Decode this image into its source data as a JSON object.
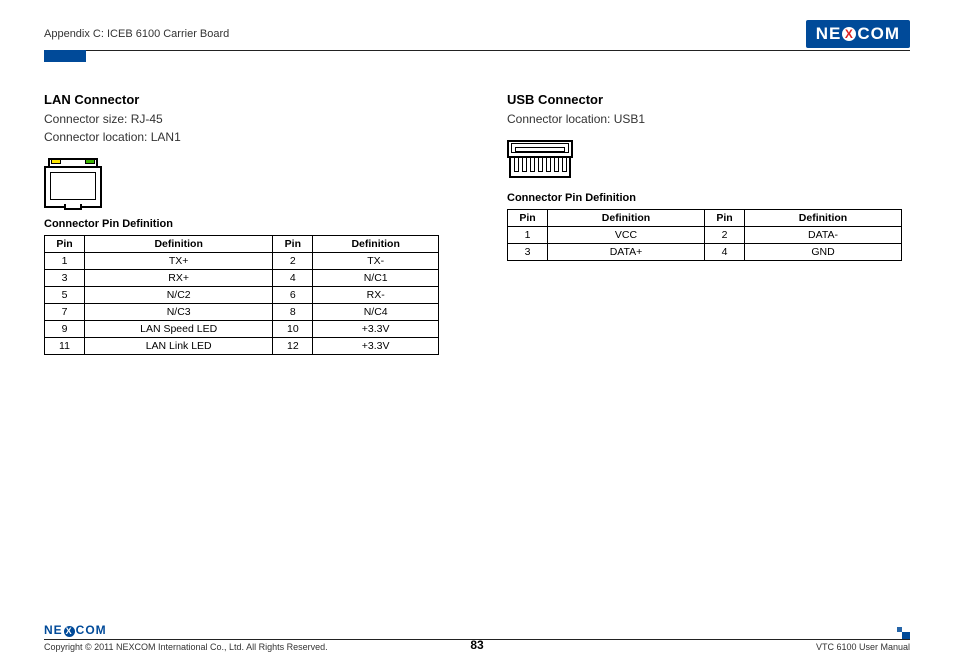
{
  "header": {
    "appendix": "Appendix C: ICEB 6100 Carrier Board",
    "logo_left": "NE",
    "logo_x": "X",
    "logo_right": "COM"
  },
  "lan": {
    "title": "LAN Connector",
    "size": "Connector size: RJ-45",
    "location": "Connector location: LAN1",
    "table_title": "Connector Pin Definition",
    "col_pin": "Pin",
    "col_def": "Definition",
    "rows": [
      {
        "p1": "1",
        "d1": "TX+",
        "p2": "2",
        "d2": "TX-"
      },
      {
        "p1": "3",
        "d1": "RX+",
        "p2": "4",
        "d2": "N/C1"
      },
      {
        "p1": "5",
        "d1": "N/C2",
        "p2": "6",
        "d2": "RX-"
      },
      {
        "p1": "7",
        "d1": "N/C3",
        "p2": "8",
        "d2": "N/C4"
      },
      {
        "p1": "9",
        "d1": "LAN Speed LED",
        "p2": "10",
        "d2": "+3.3V"
      },
      {
        "p1": "11",
        "d1": "LAN Link LED",
        "p2": "12",
        "d2": "+3.3V"
      }
    ]
  },
  "usb": {
    "title": "USB Connector",
    "location": "Connector location: USB1",
    "table_title": "Connector Pin Definition",
    "col_pin": "Pin",
    "col_def": "Definition",
    "rows": [
      {
        "p1": "1",
        "d1": "VCC",
        "p2": "2",
        "d2": "DATA-"
      },
      {
        "p1": "3",
        "d1": "DATA+",
        "p2": "4",
        "d2": "GND"
      }
    ]
  },
  "footer": {
    "logo_left": "NE",
    "logo_x": "X",
    "logo_right": "COM",
    "copyright": "Copyright © 2011 NEXCOM International Co., Ltd. All Rights Reserved.",
    "manual": "VTC 6100 User Manual",
    "page": "83"
  }
}
